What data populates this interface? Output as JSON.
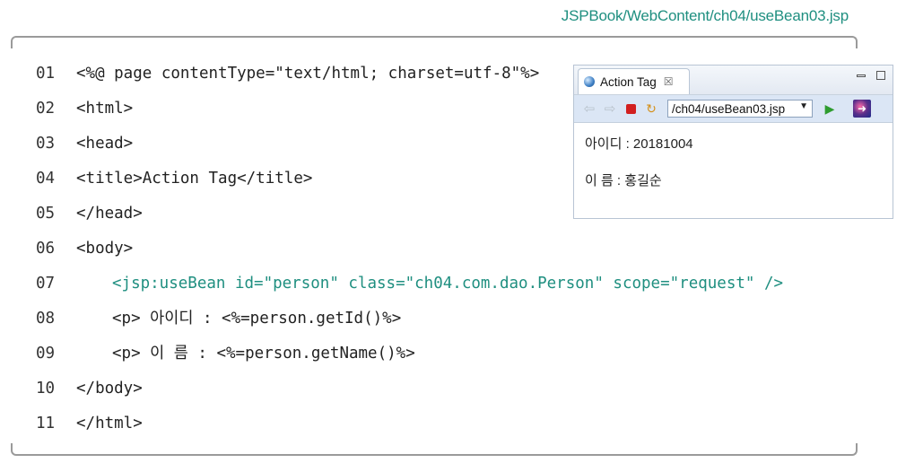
{
  "file_path": "JSPBook/WebContent/ch04/useBean03.jsp",
  "code_lines": [
    {
      "num": "01",
      "text": "<%@ page contentType=\"text/html; charset=utf-8\"%>"
    },
    {
      "num": "02",
      "text": "<html>"
    },
    {
      "num": "03",
      "text": "<head>"
    },
    {
      "num": "04",
      "text": "<title>Action Tag</title>"
    },
    {
      "num": "05",
      "text": "</head>"
    },
    {
      "num": "06",
      "text": "<body>"
    },
    {
      "num": "07",
      "text": "<jsp:useBean id=\"person\" class=\"ch04.com.dao.Person\" scope=\"request\" />"
    },
    {
      "num": "08",
      "text": "<p> 아이디 : <%=person.getId()%>"
    },
    {
      "num": "09",
      "text": "<p> 이 름 : <%=person.getName()%>"
    },
    {
      "num": "10",
      "text": "</body>"
    },
    {
      "num": "11",
      "text": "</html>"
    }
  ],
  "browser": {
    "tab_title": "Action Tag",
    "tab_close": "☒",
    "url": "/ch04/useBean03.jsp",
    "content": [
      "아이디 : 20181004",
      "이 름 : 홍길순"
    ]
  },
  "colors": {
    "accent_teal": "#1f8f80",
    "frame_gray": "#9a9a9a",
    "toolbar_blue": "#dbe6f5"
  }
}
